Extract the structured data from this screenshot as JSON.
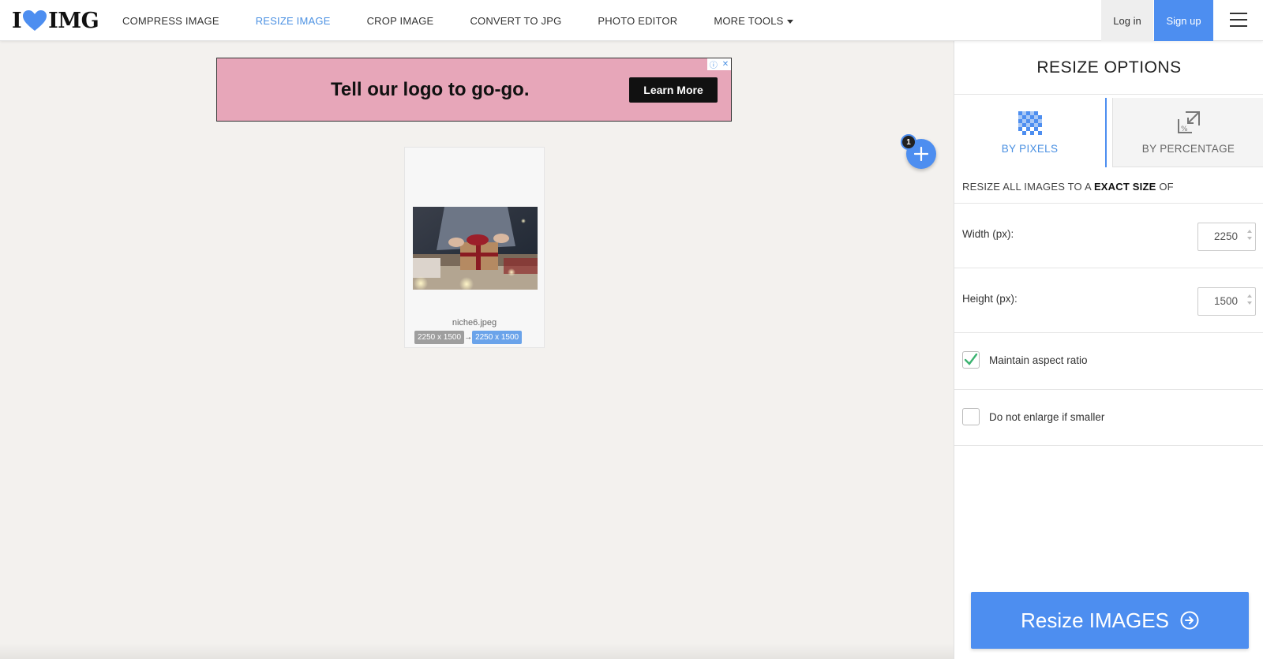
{
  "header": {
    "logo_left": "I",
    "logo_right": "IMG",
    "nav": [
      {
        "label": "COMPRESS IMAGE"
      },
      {
        "label": "RESIZE IMAGE"
      },
      {
        "label": "CROP IMAGE"
      },
      {
        "label": "CONVERT TO JPG"
      },
      {
        "label": "PHOTO EDITOR"
      },
      {
        "label": "MORE TOOLS"
      }
    ],
    "active_nav": "RESIZE IMAGE",
    "login_label": "Log in",
    "signup_label": "Sign up"
  },
  "ad": {
    "text": "Tell our logo to go-go.",
    "button_label": "Learn More"
  },
  "image_card": {
    "filename": "niche6.jpeg",
    "original_size": "2250 x 1500",
    "new_size": "2250 x 1500"
  },
  "add_button": {
    "badge_count": "1"
  },
  "sidebar": {
    "title": "RESIZE OPTIONS",
    "tabs": [
      {
        "label": "BY PIXELS",
        "active": true
      },
      {
        "label": "BY PERCENTAGE",
        "active": false
      }
    ],
    "description_prefix": "RESIZE ALL IMAGES TO A",
    "description_bold": "EXACT SIZE",
    "description_suffix": "OF",
    "width_label": "Width (px):",
    "width_value": "2250",
    "height_label": "Height (px):",
    "height_value": "1500",
    "maintain_aspect_label": "Maintain aspect ratio",
    "maintain_aspect_checked": true,
    "no_enlarge_label": "Do not enlarge if smaller",
    "no_enlarge_checked": false,
    "resize_button_label": "Resize IMAGES"
  },
  "colors": {
    "accent": "#4d8ef0",
    "ad_background": "#e7a6b9",
    "check_green": "#3cb371"
  }
}
